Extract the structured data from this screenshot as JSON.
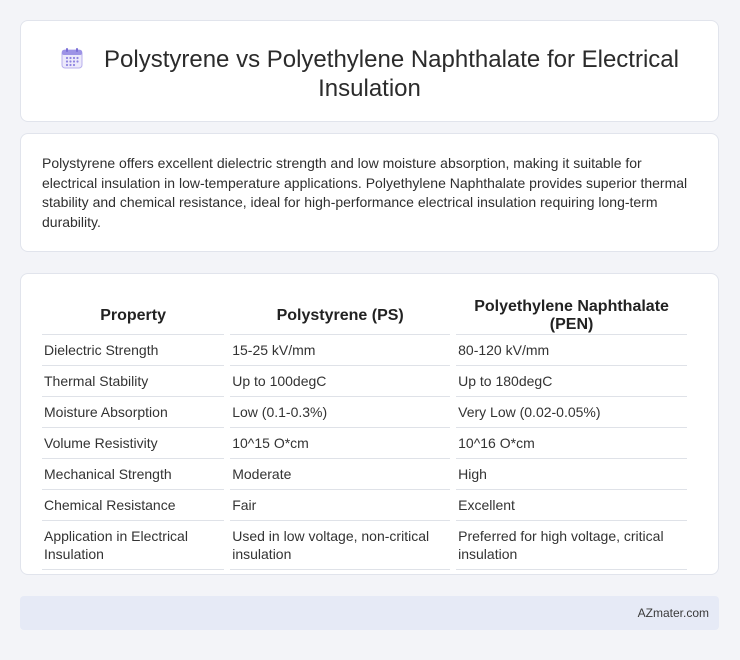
{
  "title": "Polystyrene vs Polyethylene Naphthalate for Electrical Insulation",
  "icon": "calendar-icon",
  "accent_color": "#7b6fd6",
  "description": "Polystyrene offers excellent dielectric strength and low moisture absorption, making it suitable for electrical insulation in low-temperature applications. Polyethylene Naphthalate provides superior thermal stability and chemical resistance, ideal for high-performance electrical insulation requiring long-term durability.",
  "table": {
    "headers": [
      "Property",
      "Polystyrene (PS)",
      "Polyethylene Naphthalate (PEN)"
    ],
    "rows": [
      [
        "Dielectric Strength",
        "15-25 kV/mm",
        "80-120 kV/mm"
      ],
      [
        "Thermal Stability",
        "Up to 100degC",
        "Up to 180degC"
      ],
      [
        "Moisture Absorption",
        "Low (0.1-0.3%)",
        "Very Low (0.02-0.05%)"
      ],
      [
        "Volume Resistivity",
        "10^15 O*cm",
        "10^16 O*cm"
      ],
      [
        "Mechanical Strength",
        "Moderate",
        "High"
      ],
      [
        "Chemical Resistance",
        "Fair",
        "Excellent"
      ],
      [
        "Application in Electrical Insulation",
        "Used in low voltage, non-critical insulation",
        "Preferred for high voltage, critical insulation"
      ]
    ]
  },
  "footer": "AZmater.com"
}
